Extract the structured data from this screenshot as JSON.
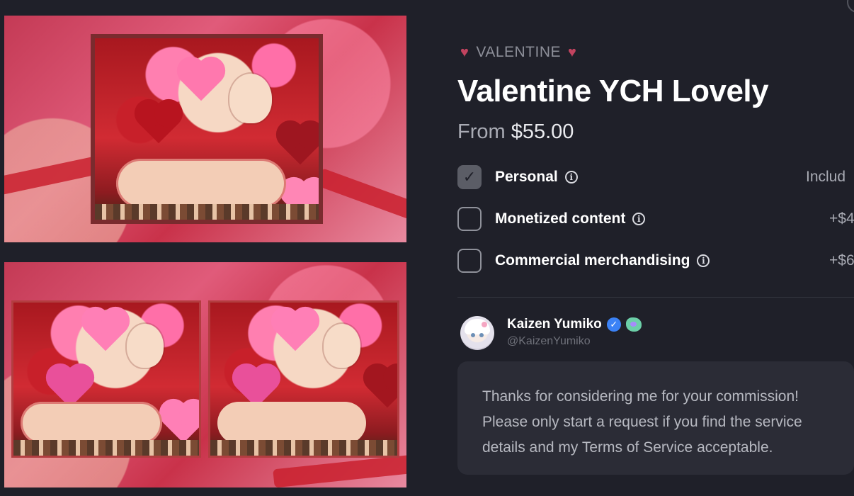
{
  "gallery": {
    "images": [
      {
        "alt": "Valentine YCH preview 1",
        "name": "gallery-image-1"
      },
      {
        "alt": "Valentine YCH preview 2",
        "name": "gallery-image-2"
      }
    ]
  },
  "listing": {
    "category": "VALENTINE",
    "category_icon": "purple-heart-icon",
    "title": "Valentine YCH Lovely",
    "price_prefix": "From",
    "price": "$55.00"
  },
  "licenses": [
    {
      "label": "Personal",
      "checked": true,
      "value": "Includ"
    },
    {
      "label": "Monetized content",
      "checked": false,
      "value": "+$4"
    },
    {
      "label": "Commercial merchandising",
      "checked": false,
      "value": "+$6"
    }
  ],
  "author": {
    "name": "Kaizen Yumiko",
    "handle": "@KaizenYumiko",
    "verified": true,
    "badge_icon": "green-creature-badge-icon"
  },
  "message": {
    "lines": [
      "Thanks for considering me for your commission!",
      "Please only start a request if you find the service",
      "details and my Terms of Service acceptable."
    ]
  },
  "colors": {
    "background": "#1f2029",
    "card": "#2b2c36",
    "heart": "#c2435f",
    "verified": "#3b82f6"
  }
}
